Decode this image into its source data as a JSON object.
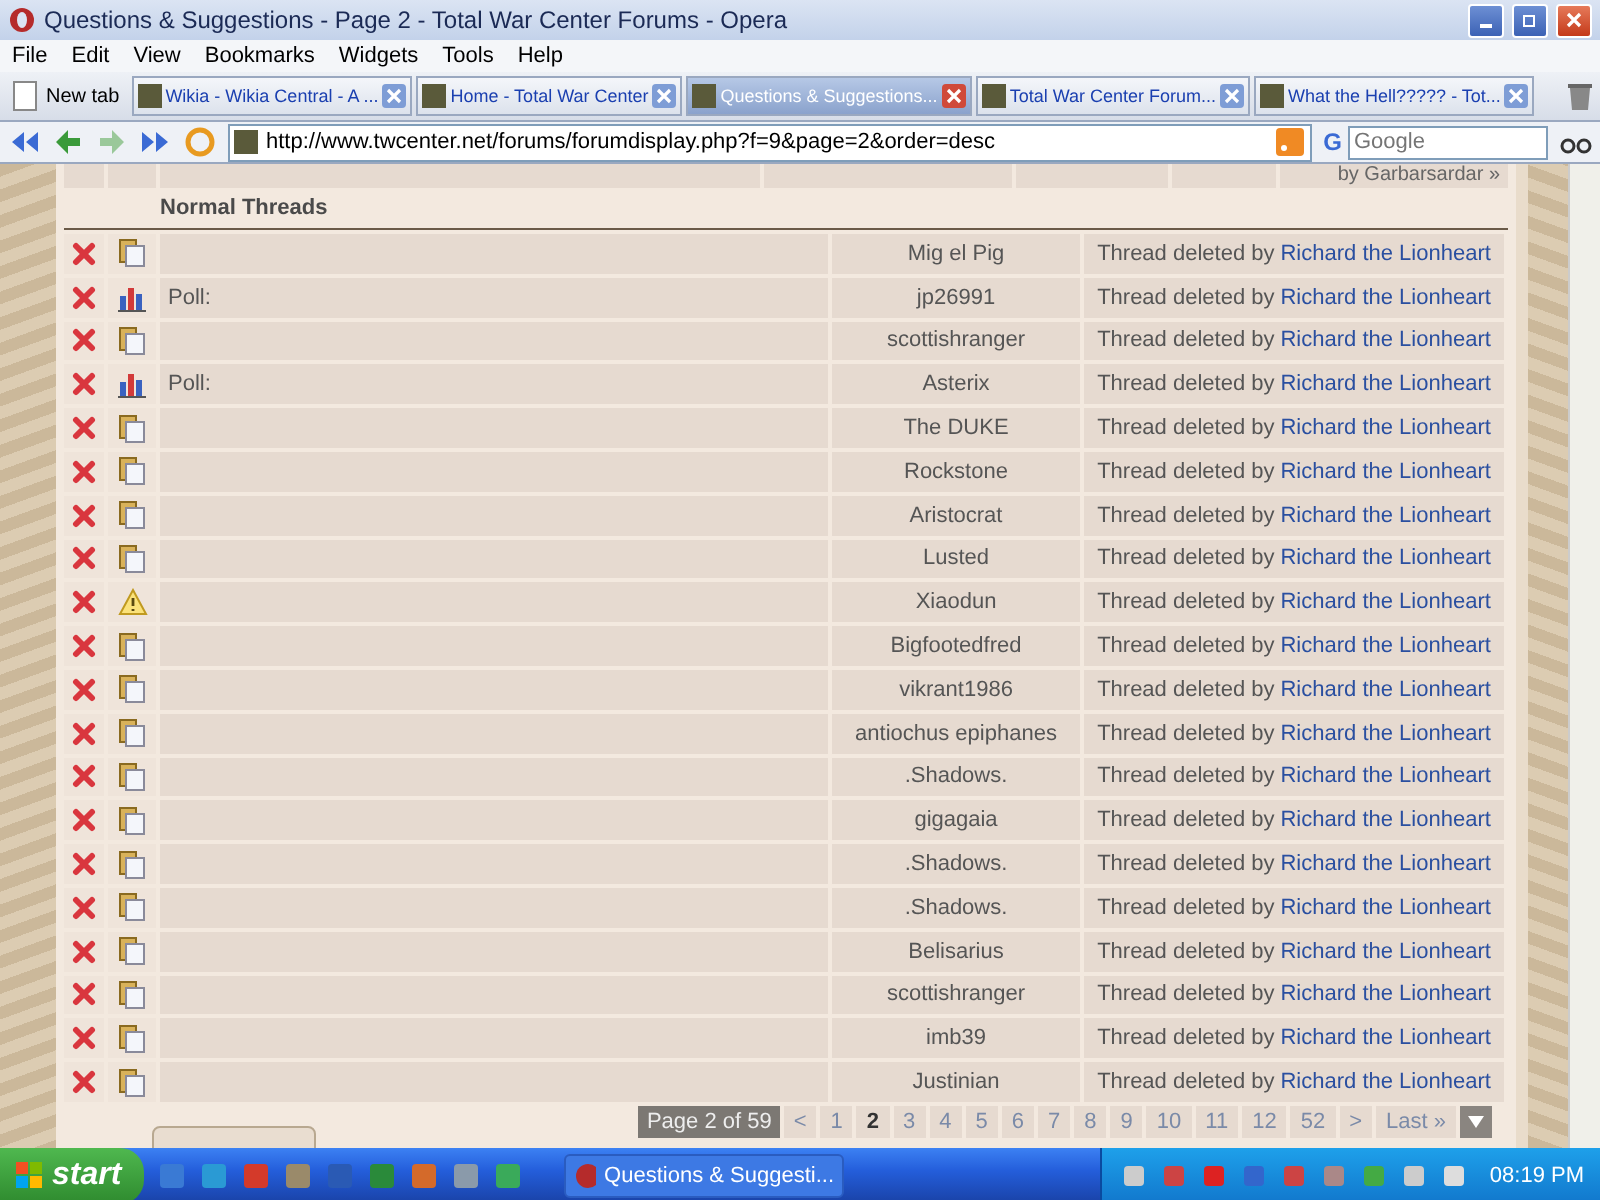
{
  "window": {
    "title": "Questions & Suggestions - Page 2 - Total War Center Forums - Opera"
  },
  "menu": [
    "File",
    "Edit",
    "View",
    "Bookmarks",
    "Widgets",
    "Tools",
    "Help"
  ],
  "new_tab": "New tab",
  "tabs": [
    {
      "label": "Wikia - Wikia Central - A ...",
      "selected": false
    },
    {
      "label": "Home - Total War Center",
      "selected": false
    },
    {
      "label": "Questions & Suggestions...",
      "selected": true
    },
    {
      "label": "Total War Center Forum...",
      "selected": false
    },
    {
      "label": "What the Hell????? - Tot...",
      "selected": false
    }
  ],
  "address": {
    "url": "http://www.twcenter.net/forums/forumdisplay.php?f=9&page=2&order=desc"
  },
  "search": {
    "logo": "G",
    "placeholder": "Google"
  },
  "previous_row": {
    "text": "by Garbarsardar",
    "arrow": "»"
  },
  "section_title": "Normal Threads",
  "threads": [
    {
      "kind": "folder",
      "author": "Mig el Pig",
      "status": "Thread deleted by",
      "moderator": "Richard the Lionheart"
    },
    {
      "kind": "poll",
      "prefix": "Poll:",
      "author": "jp26991",
      "status": "Thread deleted by",
      "moderator": "Richard the Lionheart"
    },
    {
      "kind": "folder",
      "author": "scottishranger",
      "status": "Thread deleted by",
      "moderator": "Richard the Lionheart"
    },
    {
      "kind": "poll",
      "prefix": "Poll:",
      "author": "Asterix",
      "status": "Thread deleted by",
      "moderator": "Richard the Lionheart"
    },
    {
      "kind": "folder",
      "author": "The DUKE",
      "status": "Thread deleted by",
      "moderator": "Richard the Lionheart"
    },
    {
      "kind": "folder",
      "author": "Rockstone",
      "status": "Thread deleted by",
      "moderator": "Richard the Lionheart"
    },
    {
      "kind": "folder",
      "author": "Aristocrat",
      "status": "Thread deleted by",
      "moderator": "Richard the Lionheart"
    },
    {
      "kind": "folder",
      "author": "Lusted",
      "status": "Thread deleted by",
      "moderator": "Richard the Lionheart"
    },
    {
      "kind": "warning",
      "author": "Xiaodun",
      "status": "Thread deleted by",
      "moderator": "Richard the Lionheart"
    },
    {
      "kind": "folder",
      "author": "Bigfootedfred",
      "status": "Thread deleted by",
      "moderator": "Richard the Lionheart"
    },
    {
      "kind": "folder",
      "author": "vikrant1986",
      "status": "Thread deleted by",
      "moderator": "Richard the Lionheart"
    },
    {
      "kind": "folder",
      "author": "antiochus epiphanes",
      "status": "Thread deleted by",
      "moderator": "Richard the Lionheart"
    },
    {
      "kind": "folder",
      "author": ".Shadows.",
      "status": "Thread deleted by",
      "moderator": "Richard the Lionheart"
    },
    {
      "kind": "folder",
      "author": "gigagaia",
      "status": "Thread deleted by",
      "moderator": "Richard the Lionheart"
    },
    {
      "kind": "folder",
      "author": ".Shadows.",
      "status": "Thread deleted by",
      "moderator": "Richard the Lionheart"
    },
    {
      "kind": "folder",
      "author": ".Shadows.",
      "status": "Thread deleted by",
      "moderator": "Richard the Lionheart"
    },
    {
      "kind": "folder",
      "author": "Belisarius",
      "status": "Thread deleted by",
      "moderator": "Richard the Lionheart"
    },
    {
      "kind": "folder",
      "author": "scottishranger",
      "status": "Thread deleted by",
      "moderator": "Richard the Lionheart"
    },
    {
      "kind": "folder",
      "author": "imb39",
      "status": "Thread deleted by",
      "moderator": "Richard the Lionheart"
    },
    {
      "kind": "folder",
      "author": "Justinian",
      "status": "Thread deleted by",
      "moderator": "Richard the Lionheart"
    }
  ],
  "pagination": {
    "label": "Page 2 of 59",
    "prev": "<",
    "next": ">",
    "last": "Last »",
    "pages": [
      {
        "label": "1",
        "selected": false
      },
      {
        "label": "2",
        "selected": true
      },
      {
        "label": "3",
        "selected": false
      },
      {
        "label": "4",
        "selected": false
      },
      {
        "label": "5",
        "selected": false
      },
      {
        "label": "6",
        "selected": false
      },
      {
        "label": "7",
        "selected": false
      },
      {
        "label": "8",
        "selected": false
      },
      {
        "label": "9",
        "selected": false
      },
      {
        "label": "10",
        "selected": false
      },
      {
        "label": "11",
        "selected": false
      },
      {
        "label": "12",
        "selected": false
      },
      {
        "label": "52",
        "selected": false
      }
    ]
  },
  "taskbar": {
    "start": "start",
    "task": "Questions & Suggesti...",
    "clock": "08:19 PM"
  }
}
